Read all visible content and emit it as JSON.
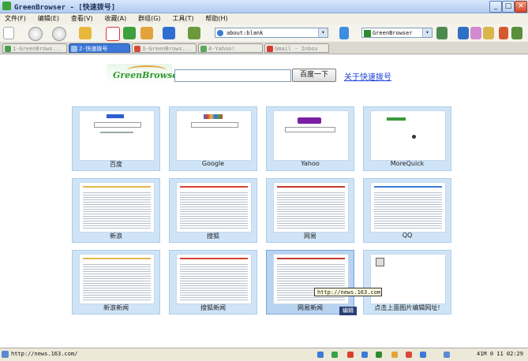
{
  "window": {
    "title": "GreenBrowser - [快速拨号]"
  },
  "menu": [
    "文件(F)",
    "编辑(E)",
    "查看(V)",
    "收藏(A)",
    "群组(G)",
    "工具(T)",
    "帮助(H)"
  ],
  "address": {
    "value": "about:blank"
  },
  "search_engine": {
    "value": "GreenBrowser"
  },
  "tabs": [
    {
      "label": "1-GreenBrows...",
      "active": false
    },
    {
      "label": "2-快速拨号",
      "active": true
    },
    {
      "label": "3-GreenBrows...",
      "active": false
    },
    {
      "label": "4-Yahoo!",
      "active": false
    },
    {
      "label": "Gmail - Inbox",
      "active": false
    }
  ],
  "speeddial": {
    "logo_text": "GreenBrowser",
    "search_button": "百度一下",
    "about_link": "关于快速拨号",
    "tiles": [
      {
        "label": "百度"
      },
      {
        "label": "Google"
      },
      {
        "label": "Yahoo"
      },
      {
        "label": "MoreQuick"
      },
      {
        "label": "新浪"
      },
      {
        "label": "搜狐"
      },
      {
        "label": "网易"
      },
      {
        "label": "QQ"
      },
      {
        "label": "新浪新闻"
      },
      {
        "label": "搜狐新闻"
      },
      {
        "label": "网易新闻"
      },
      {
        "label": "点击上面图片编辑网址!"
      }
    ],
    "tooltip": "http://news.163.com",
    "edit_button": "编辑"
  },
  "status": {
    "url": "http://news.163.com/",
    "clock": "41M 0 11 02:29"
  },
  "colors": {
    "accent": "#3d78d8",
    "tile": "#cfe4f7",
    "link": "#1a3fd6"
  }
}
